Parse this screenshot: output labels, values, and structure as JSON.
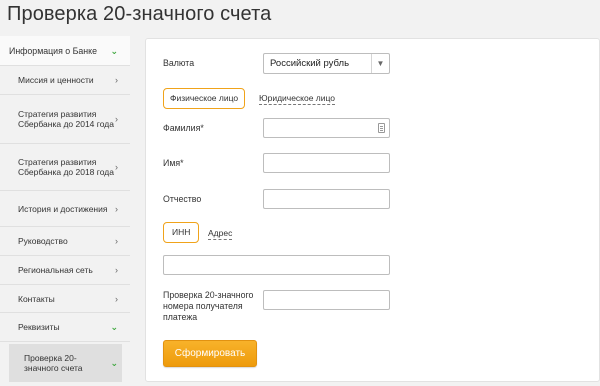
{
  "page": {
    "title": "Проверка 20-значного счета"
  },
  "sidebar": {
    "items": [
      {
        "label": "Информация о Банке",
        "chevron": "chevron-down-icon"
      },
      {
        "label": "Миссия и ценности",
        "chevron": "chevron-right-icon"
      },
      {
        "label": "Стратегия развития Сбербанка до 2014 года",
        "chevron": "chevron-right-icon"
      },
      {
        "label": "Стратегия развития Сбербанка до 2018 года",
        "chevron": "chevron-right-icon"
      },
      {
        "label": "История и достижения",
        "chevron": "chevron-right-icon"
      },
      {
        "label": "Руководство",
        "chevron": "chevron-right-icon"
      },
      {
        "label": "Региональная сеть",
        "chevron": "chevron-right-icon"
      },
      {
        "label": "Контакты",
        "chevron": "chevron-right-icon"
      },
      {
        "label": "Реквизиты",
        "chevron": "chevron-down-icon"
      },
      {
        "label": "Проверка 20-значного счета",
        "chevron": "chevron-down-icon"
      }
    ]
  },
  "form": {
    "currency_label": "Валюта",
    "currency_value": "Российский рубль",
    "person_tabs": [
      {
        "label": "Физическое лицо",
        "active": true
      },
      {
        "label": "Юридическое лицо",
        "active": false
      }
    ],
    "surname_label": "Фамилия*",
    "name_label": "Имя*",
    "patronymic_label": "Отчество",
    "id_tabs": [
      {
        "label": "ИНН",
        "active": true
      },
      {
        "label": "Адрес",
        "active": false
      }
    ],
    "check_label": "Проверка 20-значного номера получателя платежа",
    "submit_label": "Сформировать"
  },
  "colors": {
    "accent": "#f0a31a",
    "chevron_active": "#3aa53a",
    "button": "#f4a61d"
  }
}
